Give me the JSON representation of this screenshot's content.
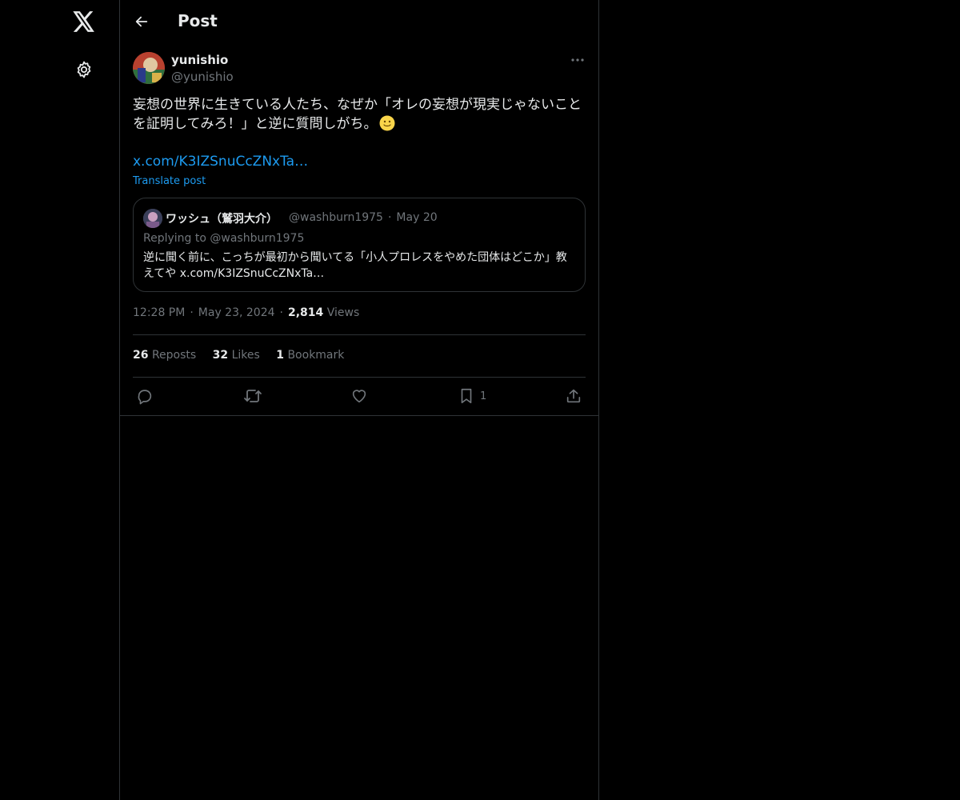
{
  "nav": {
    "logo_icon": "x-logo-icon",
    "settings_icon": "gear-icon"
  },
  "header": {
    "title": "Post",
    "back_icon": "arrow-left-icon"
  },
  "post": {
    "display_name": "yunishio",
    "handle": "@yunishio",
    "text": "妄想の世界に生きている人たち、なぜか「オレの妄想が現実じゃないことを証明してみろ！」と逆に質問しがち。",
    "emoji": "slightly-smiling-face",
    "link": "x.com/K3IZSnuCcZNxTa…",
    "translate_label": "Translate post",
    "time": "12:28 PM",
    "date": "May 23, 2024",
    "views_count": "2,814",
    "views_label": "Views"
  },
  "quote": {
    "display_name": "ワッシュ（鷲羽大介）",
    "handle": "@washburn1975",
    "date": "May 20",
    "replying_to": "Replying to @washburn1975",
    "text": "逆に聞く前に、こっちが最初から聞いてる「小人プロレスをやめた団体はどこか」教えてや x.com/K3IZSnuCcZNxTa…"
  },
  "stats": {
    "reposts_count": "26",
    "reposts_label": "Reposts",
    "likes_count": "32",
    "likes_label": "Likes",
    "bookmarks_count": "1",
    "bookmarks_label": "Bookmark"
  },
  "actions": {
    "reply_icon": "reply-icon",
    "repost_icon": "repost-icon",
    "like_icon": "heart-icon",
    "bookmark_icon": "bookmark-icon",
    "bookmark_count": "1",
    "share_icon": "share-icon"
  },
  "colors": {
    "background": "#000000",
    "text": "#e7e9ea",
    "muted": "#71767b",
    "link": "#1d9bf0",
    "border": "#2f3336"
  }
}
